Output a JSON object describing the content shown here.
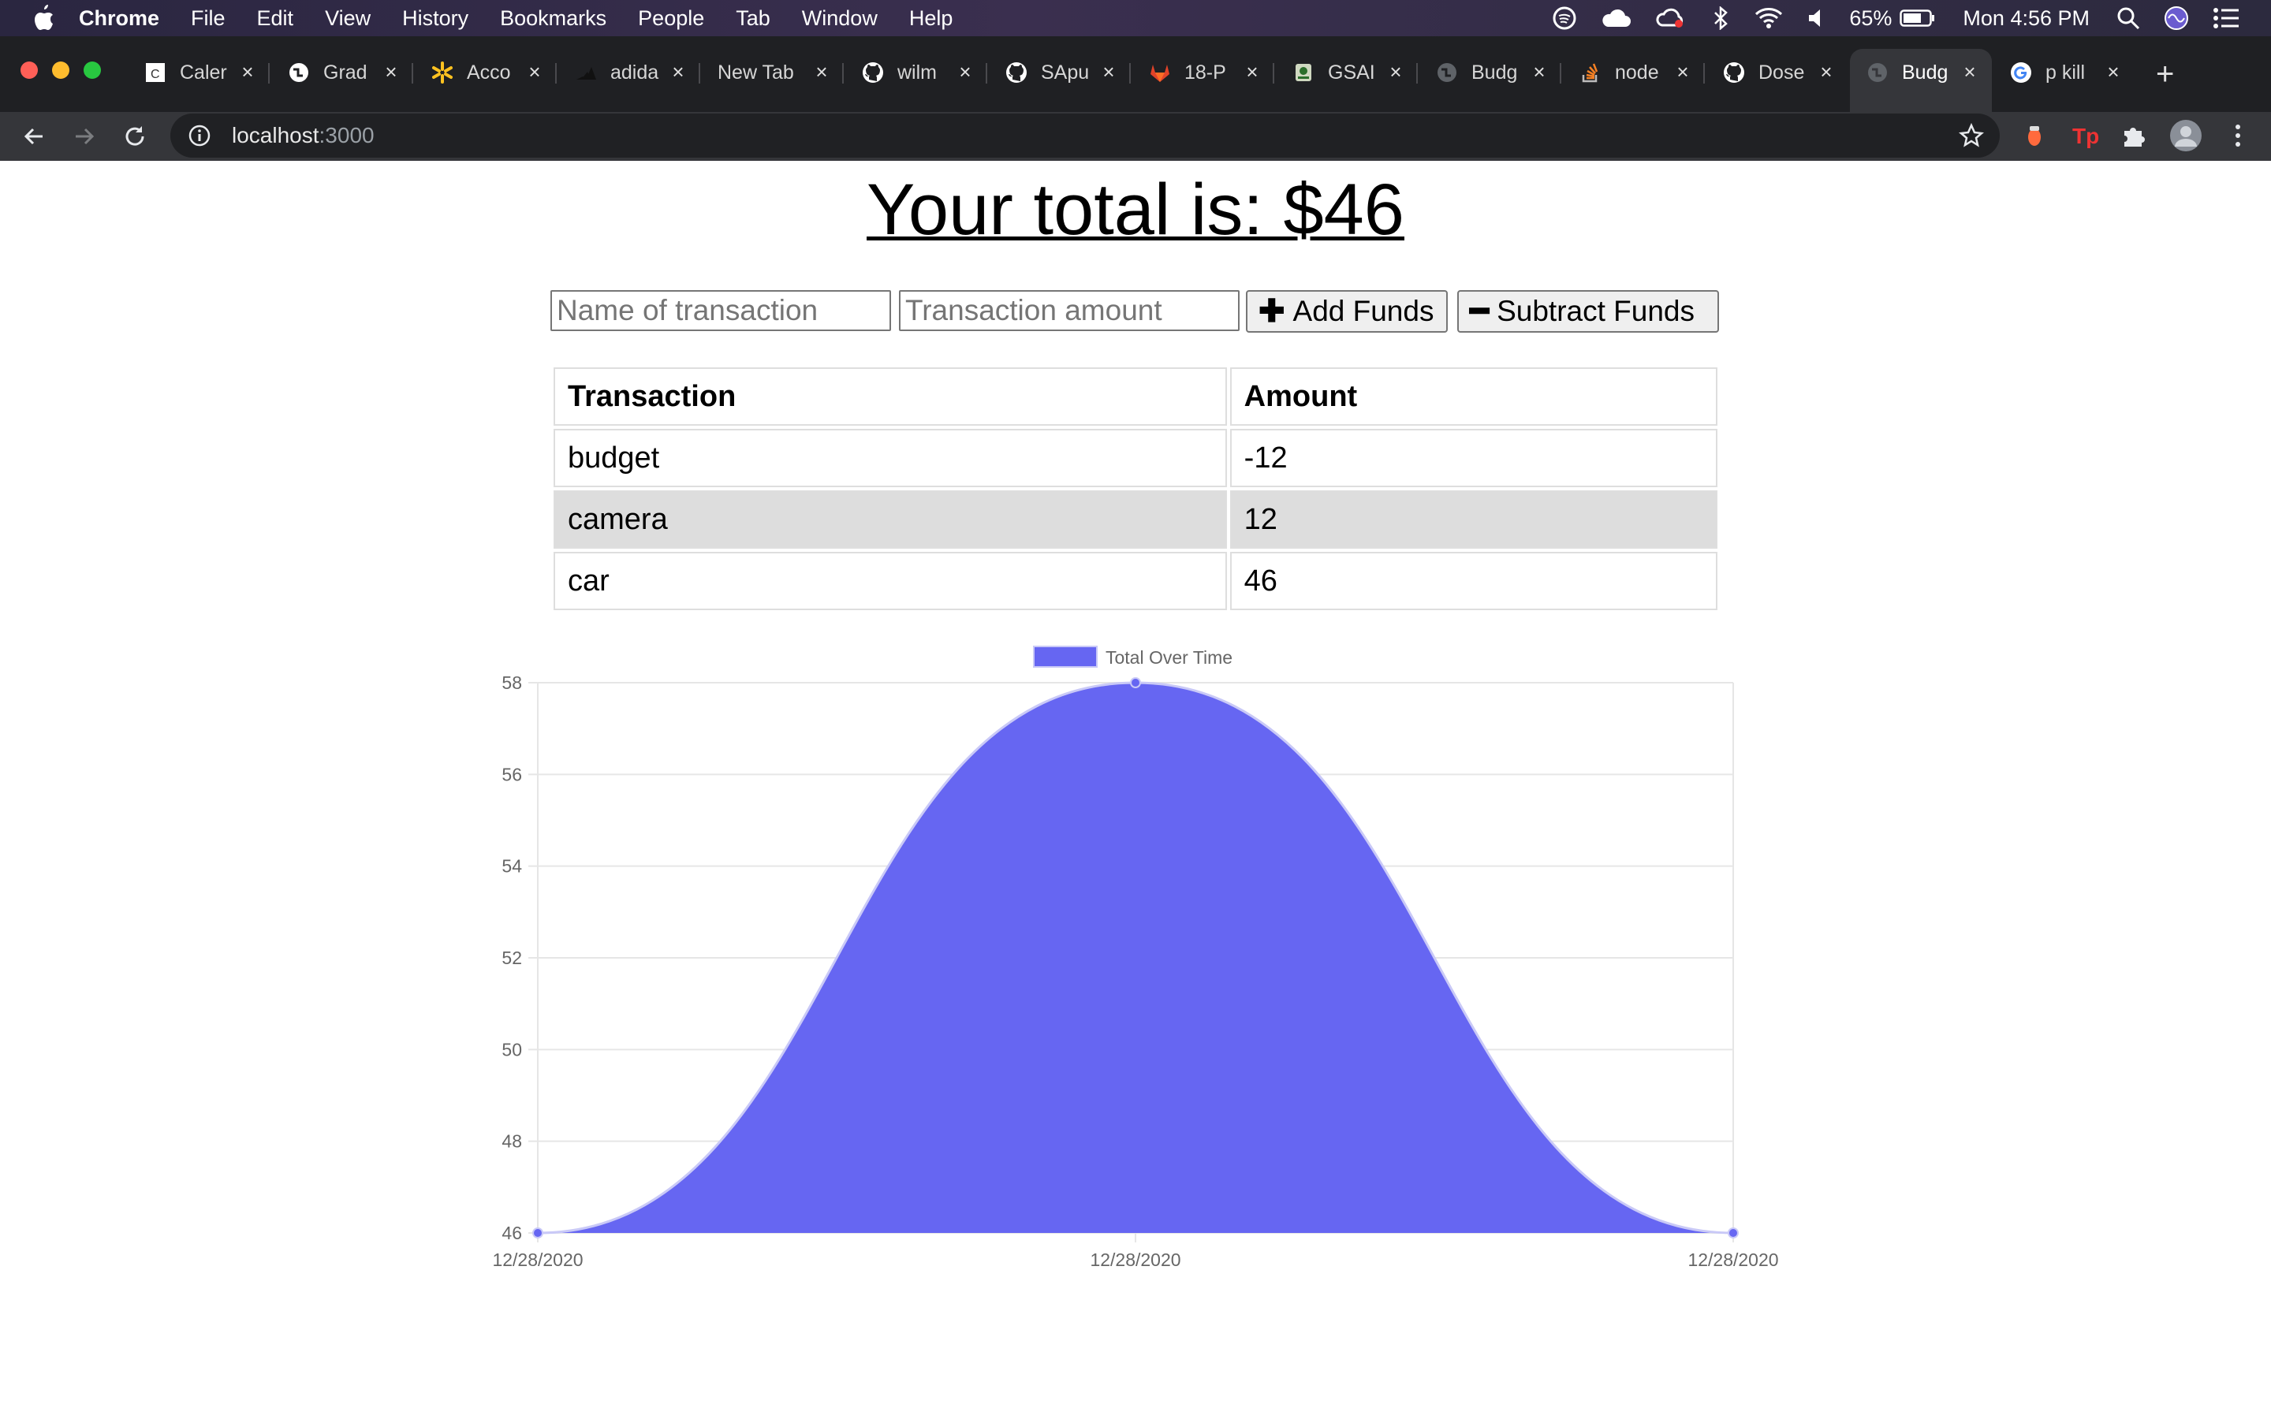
{
  "os_menubar": {
    "app": "Chrome",
    "items": [
      "File",
      "Edit",
      "View",
      "History",
      "Bookmarks",
      "People",
      "Tab",
      "Window",
      "Help"
    ],
    "battery": "65%",
    "clock": "Mon 4:56 PM"
  },
  "browser": {
    "tabs": [
      {
        "title": "Caler",
        "icon": "calendar-icon"
      },
      {
        "title": "Grad",
        "icon": "globe-icon"
      },
      {
        "title": "Acco",
        "icon": "walmart-spark-icon"
      },
      {
        "title": "adida",
        "icon": "adidas-icon"
      },
      {
        "title": "New Tab",
        "icon": ""
      },
      {
        "title": "wilm",
        "icon": "github-icon"
      },
      {
        "title": "SApu",
        "icon": "github-icon"
      },
      {
        "title": "18-P",
        "icon": "gitlab-icon"
      },
      {
        "title": "GSAI",
        "icon": "badge-icon"
      },
      {
        "title": "Budg",
        "icon": "globe-icon"
      },
      {
        "title": "node",
        "icon": "stackoverflow-icon"
      },
      {
        "title": "Dose",
        "icon": "github-icon"
      },
      {
        "title": "Budg",
        "icon": "globe-icon",
        "active": true
      },
      {
        "title": "p kill",
        "icon": "google-icon"
      }
    ],
    "url_host": "localhost",
    "url_port": ":3000"
  },
  "page": {
    "total_label": "Your total is: $46",
    "name_placeholder": "Name of transaction",
    "amount_placeholder": "Transaction amount",
    "add_button": "Add Funds",
    "add_glyph": "✚",
    "subtract_button": "Subtract Funds",
    "subtract_glyph": "━",
    "table": {
      "headers": [
        "Transaction",
        "Amount"
      ],
      "rows": [
        {
          "name": "budget",
          "amount": "-12"
        },
        {
          "name": "camera",
          "amount": "12"
        },
        {
          "name": "car",
          "amount": "46"
        }
      ]
    }
  },
  "chart_data": {
    "type": "line",
    "fill": true,
    "x": [
      "12/28/2020",
      "12/28/2020",
      "12/28/2020"
    ],
    "series": [
      {
        "name": "Total Over Time",
        "values": [
          46,
          58,
          46
        ],
        "color": "#6666f2"
      }
    ],
    "ylim": [
      46,
      58
    ],
    "yticks": [
      46,
      48,
      50,
      52,
      54,
      56,
      58
    ],
    "legend": "top",
    "grid": true
  }
}
